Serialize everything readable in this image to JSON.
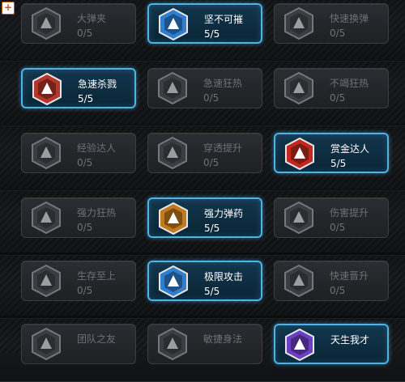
{
  "corner_button": "+",
  "rows": [
    [
      {
        "name": "大弹夹",
        "progress": "0/5",
        "active": false,
        "icon": "magazine-icon",
        "color": "#8a8d92"
      },
      {
        "name": "坚不可摧",
        "progress": "5/5",
        "active": true,
        "icon": "shield-burst-icon",
        "color": "#2f7fd1"
      },
      {
        "name": "快速换弹",
        "progress": "0/5",
        "active": false,
        "icon": "hand-icon",
        "color": "#8a8d92"
      }
    ],
    [
      {
        "name": "急速杀戮",
        "progress": "5/5",
        "active": true,
        "icon": "claw-icon",
        "color": "#b3372a"
      },
      {
        "name": "急速狂热",
        "progress": "0/5",
        "active": false,
        "icon": "rage-face-icon",
        "color": "#8a8d92"
      },
      {
        "name": "不竭狂热",
        "progress": "0/5",
        "active": false,
        "icon": "skull-icon",
        "color": "#8a8d92"
      }
    ],
    [
      {
        "name": "经验达人",
        "progress": "0/5",
        "active": false,
        "icon": "xp-plus-icon",
        "color": "#8a8d92"
      },
      {
        "name": "穿透提升",
        "progress": "0/5",
        "active": false,
        "icon": "pierce-icon",
        "color": "#8a8d92"
      },
      {
        "name": "赏金达人",
        "progress": "5/5",
        "active": true,
        "icon": "dollar-badge-icon",
        "color": "#c1281f"
      }
    ],
    [
      {
        "name": "强力狂热",
        "progress": "0/5",
        "active": false,
        "icon": "bolt-icon",
        "color": "#8a8d92"
      },
      {
        "name": "强力弹药",
        "progress": "5/5",
        "active": true,
        "icon": "ammo-icon",
        "color": "#c17a1d"
      },
      {
        "name": "伤害提升",
        "progress": "0/5",
        "active": false,
        "icon": "rifle-icon",
        "color": "#8a8d92"
      }
    ],
    [
      {
        "name": "生存至上",
        "progress": "0/5",
        "active": false,
        "icon": "medic-cross-icon",
        "color": "#8a8d92"
      },
      {
        "name": "极限攻击",
        "progress": "5/5",
        "active": true,
        "icon": "gun-icon",
        "color": "#2f7fd1"
      },
      {
        "name": "快速晋升",
        "progress": "0/5",
        "active": false,
        "icon": "rank-star-icon",
        "color": "#8a8d92"
      }
    ],
    [
      {
        "name": "团队之友",
        "progress": "",
        "active": false,
        "icon": "team-icon",
        "color": "#8a8d92"
      },
      {
        "name": "敏捷身法",
        "progress": "",
        "active": false,
        "icon": "agility-icon",
        "color": "#8a8d92"
      },
      {
        "name": "天生我才",
        "progress": "",
        "active": true,
        "icon": "eye-icon",
        "color": "#6c3fc4"
      }
    ]
  ]
}
